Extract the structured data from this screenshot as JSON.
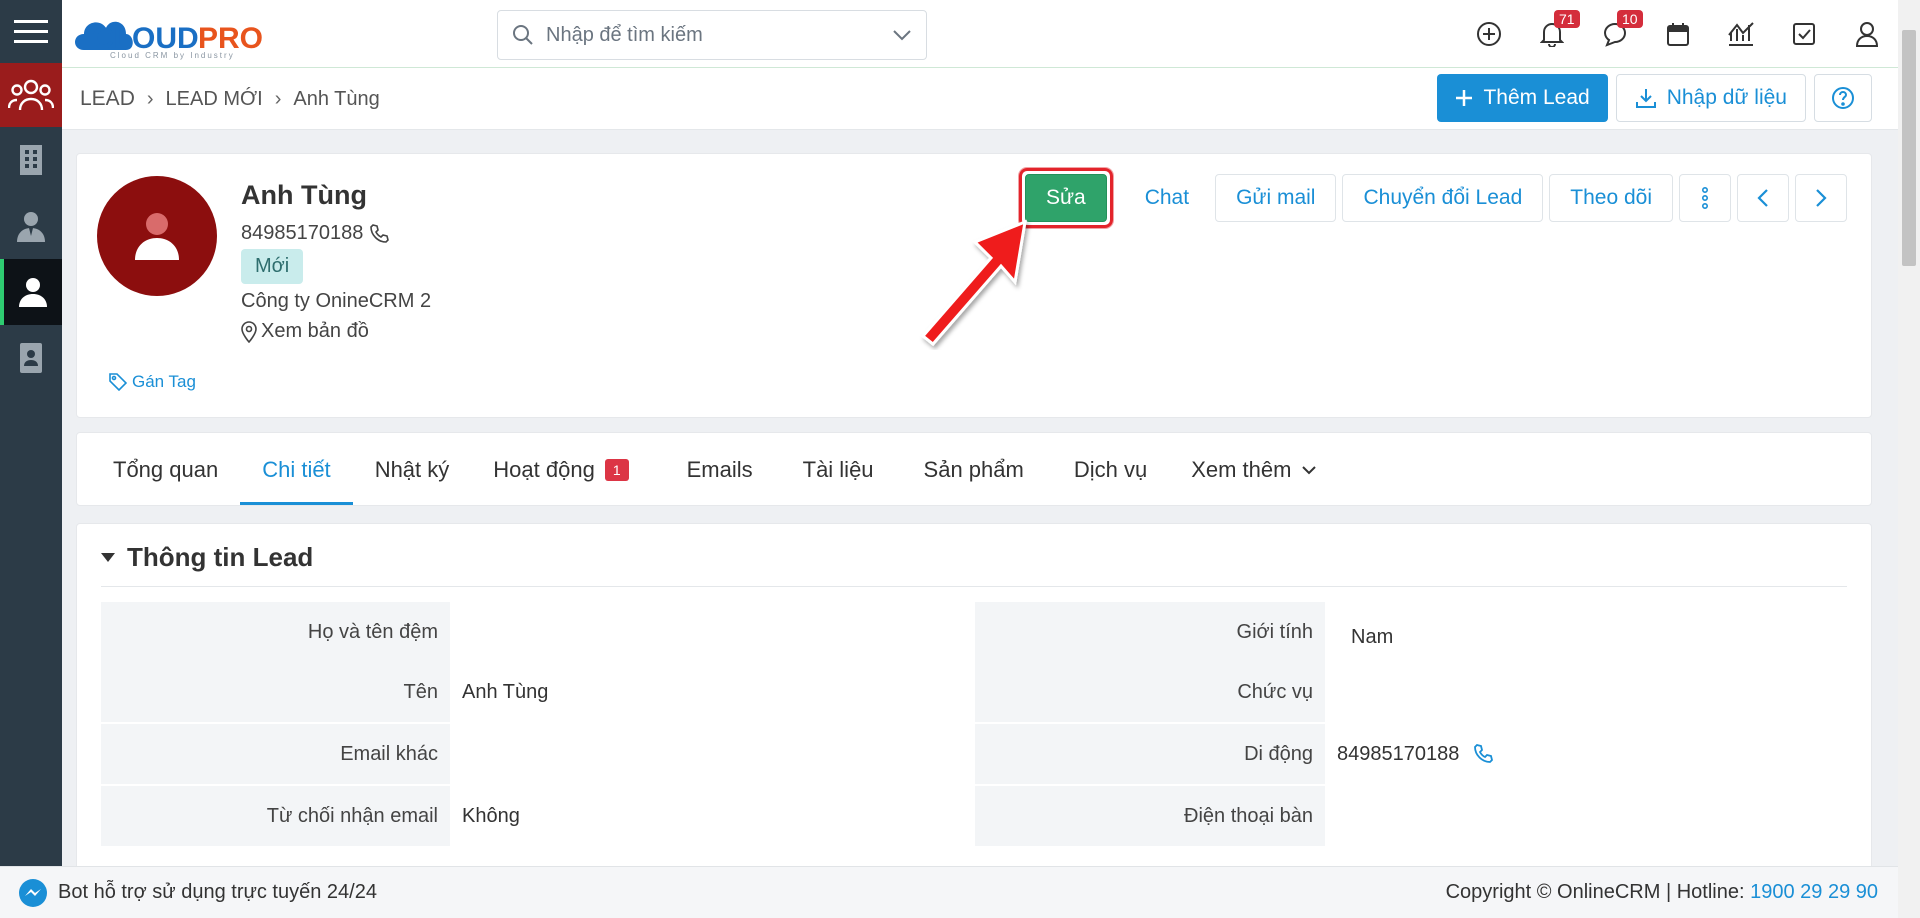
{
  "app": {
    "logo_text": "CLOUDPRO",
    "logo_tagline": "Cloud CRM by Industry"
  },
  "search": {
    "placeholder": "Nhập để tìm kiếm"
  },
  "topbar": {
    "notifications_count": "71",
    "messages_count": "10"
  },
  "breadcrumb": {
    "root": "LEAD",
    "level2": "LEAD MỚI",
    "current": "Anh Tùng"
  },
  "header_actions": {
    "add_lead": "Thêm Lead",
    "import": "Nhập dữ liệu"
  },
  "lead": {
    "name": "Anh Tùng",
    "phone": "84985170188",
    "status": "Mới",
    "company": "Công ty OnineCRM 2",
    "map_link": "Xem bản đồ",
    "tag_link": "Gán Tag"
  },
  "lead_actions": {
    "edit": "Sửa",
    "chat": "Chat",
    "send_mail": "Gửi mail",
    "convert": "Chuyển đổi Lead",
    "follow": "Theo dõi"
  },
  "tabs": [
    {
      "label": "Tổng quan"
    },
    {
      "label": "Chi tiết",
      "active": true
    },
    {
      "label": "Nhật ký"
    },
    {
      "label": "Hoạt động",
      "badge": "1"
    },
    {
      "label": "Emails"
    },
    {
      "label": "Tài liệu"
    },
    {
      "label": "Sản phẩm"
    },
    {
      "label": "Dịch vụ"
    },
    {
      "label": "Xem thêm"
    }
  ],
  "section": {
    "title": "Thông tin Lead",
    "rows": [
      {
        "left_label": "Họ và tên đệm",
        "left_value": "",
        "right_label": "Giới tính",
        "right_value": "Nam"
      },
      {
        "left_label": "Tên",
        "left_value": "Anh Tùng",
        "right_label": "Chức vụ",
        "right_value": ""
      },
      {
        "left_label": "Email khác",
        "left_value": "",
        "right_label": "Di động",
        "right_value": "84985170188"
      },
      {
        "left_label": "Từ chối nhận email",
        "left_value": "Không",
        "right_label": "Điện thoại bàn",
        "right_value": ""
      }
    ]
  },
  "footer": {
    "bot_text": "Bot hỗ trợ sử dụng trực tuyến 24/24",
    "copyright": "Copyright © OnlineCRM | Hotline: ",
    "hotline": "1900 29 29 90"
  },
  "colors": {
    "primary": "#1a8fd6",
    "edit_button": "#2fa36a",
    "sidebar": "#2c3b47",
    "sidebar_leads": "#9a1c1c",
    "avatar": "#8c0e0e",
    "badge": "#d42d3b",
    "highlight": "#e3242b"
  }
}
